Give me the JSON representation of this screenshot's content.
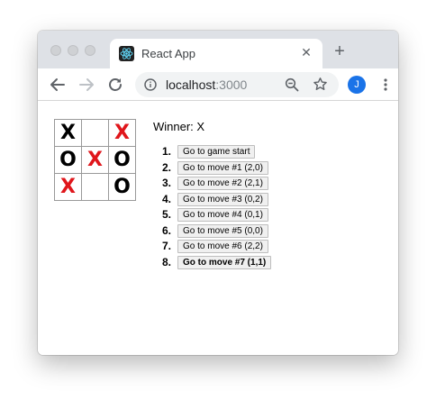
{
  "browser": {
    "tab": {
      "title": "React App",
      "favicon": "react-logo-icon"
    },
    "url": {
      "host": "localhost",
      "port": ":3000"
    },
    "profile_initial": "J",
    "colors": {
      "tabstrip": "#dee1e6",
      "avatar": "#1a73e8"
    }
  },
  "game": {
    "status": "Winner: X",
    "board": [
      [
        "X",
        "",
        "X"
      ],
      [
        "O",
        "X",
        "O"
      ],
      [
        "X",
        "",
        "O"
      ]
    ],
    "winning_cells": [
      [
        0,
        2
      ],
      [
        1,
        1
      ],
      [
        2,
        0
      ]
    ],
    "colors": {
      "mark": "#000000",
      "winning_mark": "#e0161b"
    }
  },
  "moves": [
    {
      "number": "1.",
      "label": "Go to game start",
      "current": false
    },
    {
      "number": "2.",
      "label": "Go to move #1 (2,0)",
      "current": false
    },
    {
      "number": "3.",
      "label": "Go to move #2 (2,1)",
      "current": false
    },
    {
      "number": "4.",
      "label": "Go to move #3 (0,2)",
      "current": false
    },
    {
      "number": "5.",
      "label": "Go to move #4 (0,1)",
      "current": false
    },
    {
      "number": "6.",
      "label": "Go to move #5 (0,0)",
      "current": false
    },
    {
      "number": "7.",
      "label": "Go to move #6 (2,2)",
      "current": false
    },
    {
      "number": "8.",
      "label": "Go to move #7 (1,1)",
      "current": true
    }
  ]
}
